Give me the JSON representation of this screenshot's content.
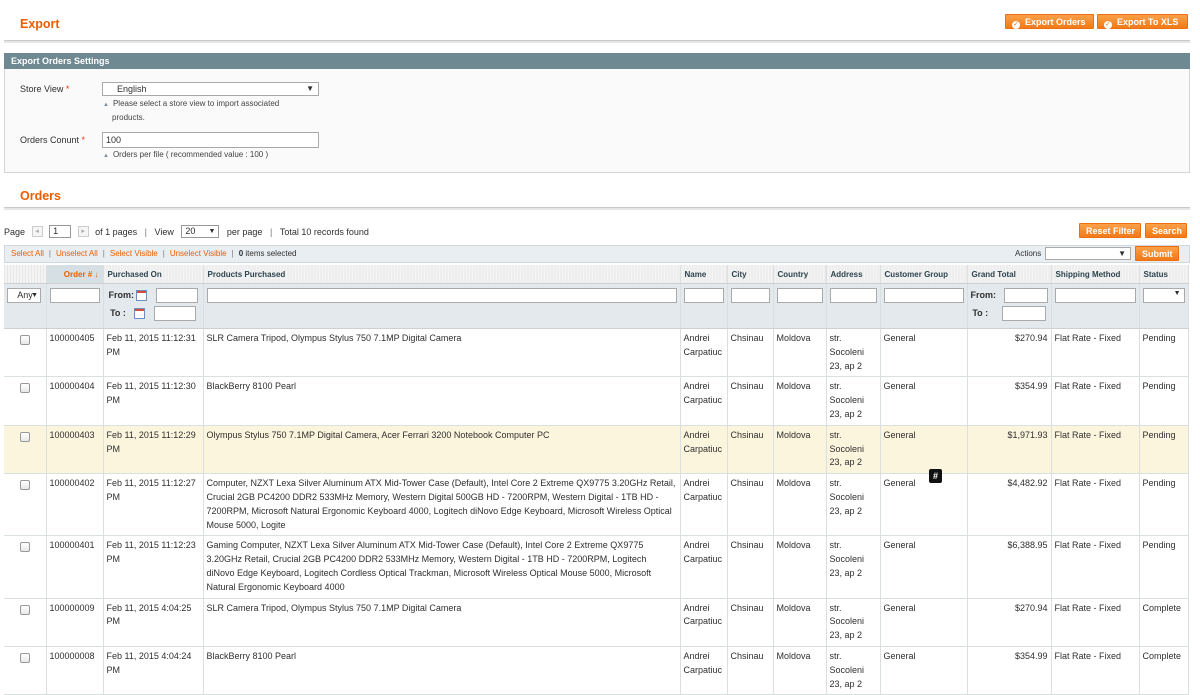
{
  "header": {
    "title": "Export",
    "buttons": {
      "export_orders": "Export Orders",
      "export_xls": "Export To XLS"
    }
  },
  "settings": {
    "heading": "Export Orders Settings",
    "store_view": {
      "label": "Store View",
      "required_mark": "*",
      "value": "English",
      "note_line1": "Please select a store view to import associated",
      "note_line2": "products."
    },
    "orders_count": {
      "label": "Orders Conunt",
      "required_mark": "*",
      "value": "100",
      "note": "Orders per file ( recommended value : 100 )"
    }
  },
  "orders": {
    "title": "Orders",
    "pager": {
      "page_label": "Page",
      "page_value": "1",
      "of_pages": "of 1 pages",
      "view_label": "View",
      "per_page_value": "20",
      "per_page_label": "per page",
      "total": "Total 10 records found"
    },
    "buttons": {
      "reset_filter": "Reset Filter",
      "search": "Search",
      "submit": "Submit"
    },
    "massaction": {
      "select_all": "Select All",
      "unselect_all": "Unselect All",
      "select_visible": "Select Visible",
      "unselect_visible": "Unselect Visible",
      "count": "0",
      "count_label": "items selected",
      "actions_label": "Actions"
    },
    "columns": [
      "Order #",
      "Purchased On",
      "Products Purchased",
      "Name",
      "City",
      "Country",
      "Address",
      "Customer Group",
      "Grand Total",
      "Shipping Method",
      "Status"
    ],
    "filters": {
      "any": "Any",
      "from": "From:",
      "to": "To :"
    },
    "rows": [
      {
        "order": "100000405",
        "date_line1": "Feb 11, 2015 11:12:31",
        "date_line2": "PM",
        "products": "SLR Camera Tripod, Olympus Stylus 750 7.1MP Digital Camera",
        "name_first": "Andrei",
        "name_last": "Carpatiuc",
        "city": "Chsinau",
        "country": "Moldova",
        "addr1": "str.",
        "addr2": "Socoleni",
        "addr3": "23, ap 2",
        "group": "General",
        "total": "$270.94",
        "shipping": "Flat Rate - Fixed",
        "status": "Pending"
      },
      {
        "order": "100000404",
        "date_line1": "Feb 11, 2015 11:12:30",
        "date_line2": "PM",
        "products": "BlackBerry 8100 Pearl",
        "name_first": "Andrei",
        "name_last": "Carpatiuc",
        "city": "Chsinau",
        "country": "Moldova",
        "addr1": "str.",
        "addr2": "Socoleni",
        "addr3": "23, ap 2",
        "group": "General",
        "total": "$354.99",
        "shipping": "Flat Rate - Fixed",
        "status": "Pending"
      },
      {
        "order": "100000403",
        "date_line1": "Feb 11, 2015 11:12:29",
        "date_line2": "PM",
        "products": "Olympus Stylus 750 7.1MP Digital Camera, Acer Ferrari 3200 Notebook Computer PC",
        "name_first": "Andrei",
        "name_last": "Carpatiuc",
        "city": "Chsinau",
        "country": "Moldova",
        "addr1": "str.",
        "addr2": "Socoleni",
        "addr3": "23, ap 2",
        "group": "General",
        "total": "$1,971.93",
        "shipping": "Flat Rate - Fixed",
        "status": "Pending"
      },
      {
        "order": "100000402",
        "date_line1": "Feb 11, 2015 11:12:27",
        "date_line2": "PM",
        "products": "Computer, NZXT Lexa Silver Aluminum ATX Mid-Tower Case (Default), Intel Core 2 Extreme QX9775 3.20GHz Retail, Crucial 2GB PC4200 DDR2 533MHz Memory, Western Digital 500GB HD - 7200RPM, Western Digital - 1TB HD - 7200RPM, Microsoft Natural Ergonomic Keyboard 4000, Logitech diNovo Edge Keyboard, Microsoft Wireless Optical Mouse 5000, Logite",
        "name_first": "Andrei",
        "name_last": "Carpatiuc",
        "city": "Chsinau",
        "country": "Moldova",
        "addr1": "str.",
        "addr2": "Socoleni",
        "addr3": "23, ap 2",
        "group": "General",
        "total": "$4,482.92",
        "shipping": "Flat Rate - Fixed",
        "status": "Pending"
      },
      {
        "order": "100000401",
        "date_line1": "Feb 11, 2015 11:12:23",
        "date_line2": "PM",
        "products": "Gaming Computer, NZXT Lexa Silver Aluminum ATX Mid-Tower Case (Default), Intel Core 2 Extreme QX9775 3.20GHz Retail, Crucial 2GB PC4200 DDR2 533MHz Memory, Western Digital - 1TB HD - 7200RPM, Logitech diNovo Edge Keyboard, Logitech Cordless Optical Trackman, Microsoft Wireless Optical Mouse 5000, Microsoft Natural Ergonomic Keyboard 4000",
        "name_first": "Andrei",
        "name_last": "Carpatiuc",
        "city": "Chsinau",
        "country": "Moldova",
        "addr1": "str.",
        "addr2": "Socoleni",
        "addr3": "23, ap 2",
        "group": "General",
        "total": "$6,388.95",
        "shipping": "Flat Rate - Fixed",
        "status": "Pending"
      },
      {
        "order": "100000009",
        "date_line1": "Feb 11, 2015 4:04:25",
        "date_line2": "PM",
        "products": "SLR Camera Tripod, Olympus Stylus 750 7.1MP Digital Camera",
        "name_first": "Andrei",
        "name_last": "Carpatiuc",
        "city": "Chsinau",
        "country": "Moldova",
        "addr1": "str.",
        "addr2": "Socoleni",
        "addr3": "23, ap 2",
        "group": "General",
        "total": "$270.94",
        "shipping": "Flat Rate - Fixed",
        "status": "Complete"
      },
      {
        "order": "100000008",
        "date_line1": "Feb 11, 2015 4:04:24",
        "date_line2": "PM",
        "products": "BlackBerry 8100 Pearl",
        "name_first": "Andrei",
        "name_last": "Carpatiuc",
        "city": "Chsinau",
        "country": "Moldova",
        "addr1": "str.",
        "addr2": "Socoleni",
        "addr3": "23, ap 2",
        "group": "General",
        "total": "$354.99",
        "shipping": "Flat Rate - Fixed",
        "status": "Complete"
      }
    ],
    "cursor_badge": "#"
  },
  "colors": {
    "accent": "#eb5e00",
    "button": "#f07a18",
    "section_head": "#6f8992",
    "row_highlight": "#fcf5dd"
  },
  "icons": {
    "button_icon": "check-circle-icon",
    "calendar": "calendar-icon",
    "sort": "sort-arrow-down-icon"
  }
}
